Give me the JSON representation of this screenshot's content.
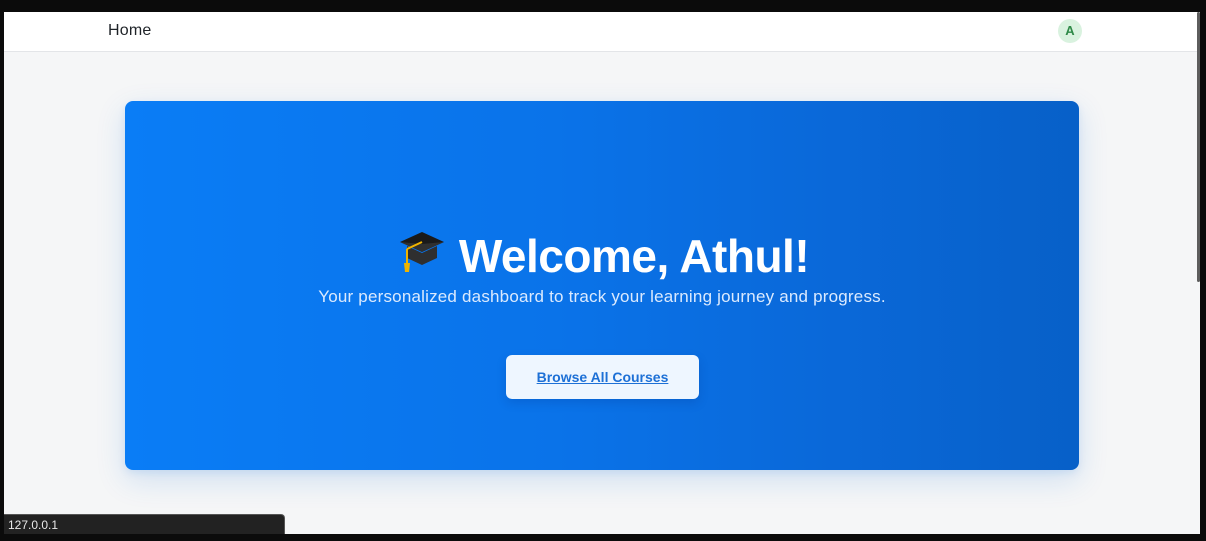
{
  "navbar": {
    "home_label": "Home",
    "avatar_initial": "A"
  },
  "hero": {
    "title": "Welcome, Athul!",
    "subtitle": "Your personalized dashboard to track your learning journey and progress.",
    "cta_label": "Browse All Courses",
    "icon": "graduation-cap-icon"
  },
  "status_bar": {
    "url": "127.0.0.1"
  },
  "colors": {
    "accent": "#0a73e9",
    "hero_start": "#0a7df6",
    "hero_end": "#0760c8",
    "button_text": "#1d70d6"
  }
}
